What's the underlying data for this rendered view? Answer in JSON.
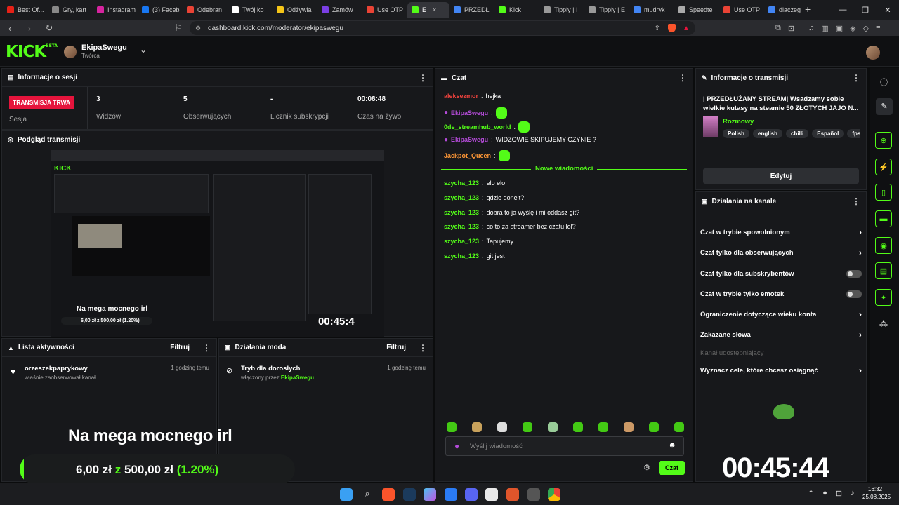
{
  "browser": {
    "tabs": [
      {
        "label": "Best Of...",
        "color": "#e62117"
      },
      {
        "label": "Gry, kart",
        "color": "#888888"
      },
      {
        "label": "Instagram",
        "color": "#d6249f"
      },
      {
        "label": "(3) Faceb",
        "color": "#1877f2"
      },
      {
        "label": "Odebran",
        "color": "#ea4335"
      },
      {
        "label": "Twój ko",
        "color": "#ffffff"
      },
      {
        "label": "Odżywia",
        "color": "#f5c518"
      },
      {
        "label": "Zamów",
        "color": "#7b3fe4"
      },
      {
        "label": "Use OTP",
        "color": "#ea4335"
      },
      {
        "label": "E",
        "color": "#53fc18",
        "active": true
      },
      {
        "label": "PRZEDŁ",
        "color": "#4285f4"
      },
      {
        "label": "Kick",
        "color": "#53fc18"
      },
      {
        "label": "Tipply | I",
        "color": "#999999"
      },
      {
        "label": "Tipply | E",
        "color": "#999999"
      },
      {
        "label": "mudryk",
        "color": "#4285f4"
      },
      {
        "label": "Speedte",
        "color": "#aaaaaa"
      },
      {
        "label": "Use OTP",
        "color": "#ea4335"
      },
      {
        "label": "dlaczeg",
        "color": "#4285f4"
      }
    ],
    "new_tab": "+",
    "url": "dashboard.kick.com/moderator/ekipaswegu"
  },
  "header": {
    "logo": "KICK",
    "logo_beta": "BETA",
    "channel_name": "EkipaSwegu",
    "channel_role": "Twórca"
  },
  "session": {
    "title": "Informacje o sesji",
    "live_badge": "TRANSMISJA TRWA",
    "session_label": "Sesja",
    "stats": [
      {
        "value": "3",
        "label": "Widzów"
      },
      {
        "value": "5",
        "label": "Obserwujących"
      },
      {
        "value": "-",
        "label": "Licznik subskrypcji"
      },
      {
        "value": "00:08:48",
        "label": "Czas na żywo"
      }
    ]
  },
  "preview": {
    "title": "Podgląd transmisji",
    "overlay_title": "Na mega mocnego irl",
    "overlay_goal": "6,00 zł z 500,00 zł (1.20%)",
    "overlay_timer": "00:45:4"
  },
  "activity": {
    "title": "Lista aktywności",
    "filter": "Filtruj",
    "item_user": "orzeszekpaprykowy",
    "item_text": "właśnie zaobserwował kanał",
    "item_time": "1 godzinę temu"
  },
  "modactions": {
    "title": "Działania moda",
    "filter": "Filtruj",
    "item_title": "Tryb dla dorosłych",
    "item_prefix": "włączony przez",
    "item_user": "EkipaSwegu",
    "item_time": "1 godzinę temu"
  },
  "overlay": {
    "title": "Na mega mocnego irl",
    "current": "6,00 zł",
    "sep": "z",
    "target": "500,00 zł",
    "percent": "(1.20%)",
    "progress_pct": 1.2,
    "timer": "00:45:44"
  },
  "chat": {
    "title": "Czat",
    "messages": [
      {
        "user": "aleksezmor",
        "color": "#e8413c",
        "text": "hejka"
      },
      {
        "user": "EkipaSwegu",
        "color": "#b44bd8",
        "text": "",
        "emote": true,
        "mic": true
      },
      {
        "user": "0de_streamhub_world",
        "color": "#53fc18",
        "text": "",
        "emote": true
      },
      {
        "user": "EkipaSwegu",
        "color": "#b44bd8",
        "text": "WIDZOWIE SKIPUJEMY CZYNIE ?",
        "mic": true
      },
      {
        "user": "Jackpot_Queen",
        "color": "#ff9736",
        "text": "",
        "emote": true
      }
    ],
    "new_messages": "Nowe wiadomości",
    "new": [
      {
        "user": "szycha_123",
        "text": "elo elo"
      },
      {
        "user": "szycha_123",
        "text": "gdzie donejt?"
      },
      {
        "user": "szycha_123",
        "text": "dobra to ja wyślę i mi oddasz git?"
      },
      {
        "user": "szycha_123",
        "text": "co to za streamer bez czatu lol?"
      },
      {
        "user": "szycha_123",
        "text": "Tapujemy"
      },
      {
        "user": "szycha_123",
        "text": "git jest"
      }
    ],
    "input_placeholder": "Wyślij wiadomość",
    "send_label": "Czat"
  },
  "stream_info": {
    "title": "Informacje o transmisji",
    "stream_title": "| PRZEDŁUŻANY STREAM| Wsadzamy sobie wielkie kutasy na steamie 50 ZŁOTYCH JAJO N...",
    "category": "Rozmowy",
    "tags": [
      "Polish",
      "english",
      "chilli",
      "Español",
      "fps"
    ],
    "edit_label": "Edytuj"
  },
  "channel_actions": {
    "title": "Działania na kanale",
    "items": [
      {
        "label": "Czat w trybie spowolnionym",
        "type": "chevron"
      },
      {
        "label": "Czat tylko dla obserwujących",
        "type": "chevron"
      },
      {
        "label": "Czat tylko dla subskrybentów",
        "type": "toggle"
      },
      {
        "label": "Czat w trybie tylko emotek",
        "type": "toggle"
      },
      {
        "label": "Ograniczenie dotyczące wieku konta",
        "type": "chevron"
      },
      {
        "label": "Zakazane słowa",
        "type": "chevron"
      },
      {
        "label": "Kanał udostępniający",
        "type": "disabled"
      },
      {
        "label": "Wyznacz cele, które chcesz osiągnąć",
        "type": "chevron"
      }
    ]
  },
  "taskbar": {
    "time": "16:32",
    "date": "25.08.2025"
  },
  "colors": {
    "accent": "#53fc18",
    "live": "#e5143c"
  }
}
